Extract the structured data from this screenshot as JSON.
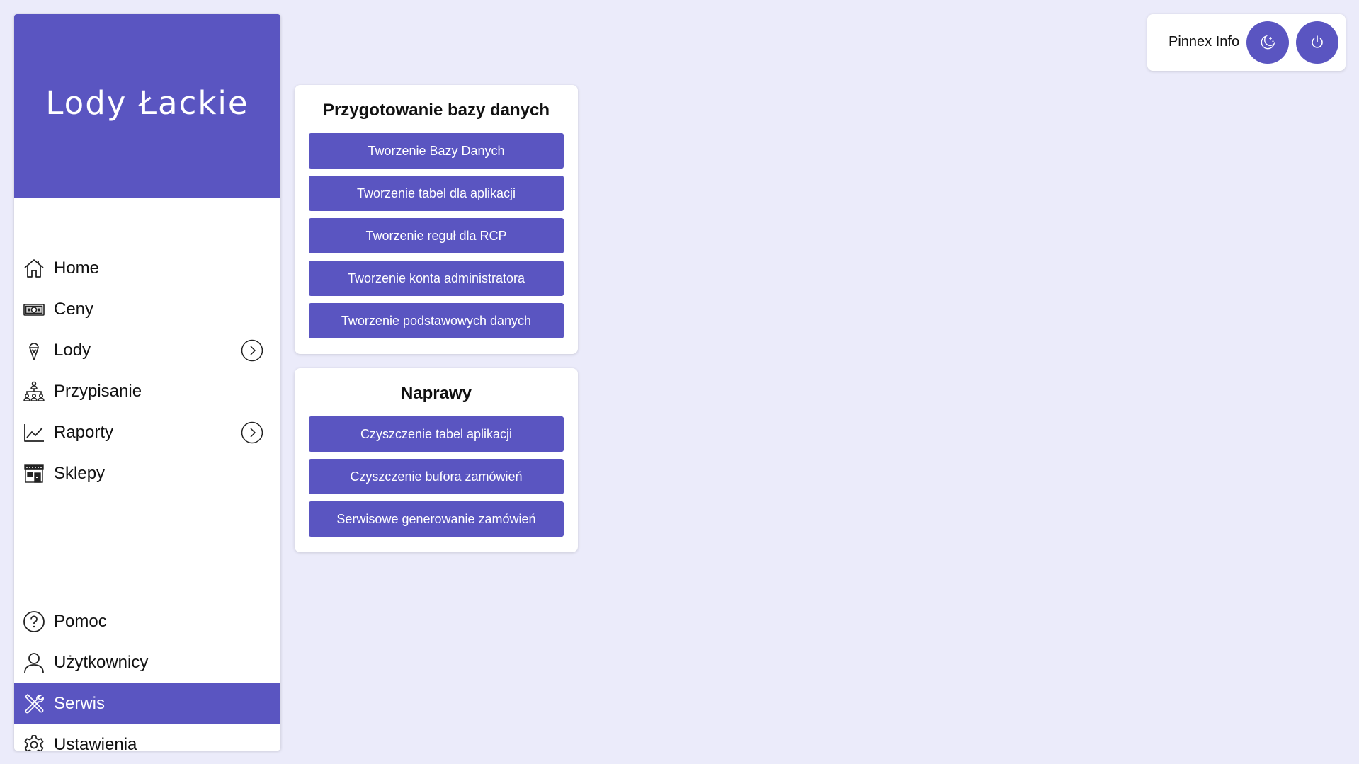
{
  "colors": {
    "accent": "#5a55c1",
    "background": "#ebebfa",
    "panel": "#ffffff"
  },
  "sidebar": {
    "brand": "Lody Łackie",
    "items": [
      {
        "label": "Home",
        "icon": "home-icon"
      },
      {
        "label": "Ceny",
        "icon": "banknote-icon"
      },
      {
        "label": "Lody",
        "icon": "ice-cream-icon",
        "expandable": true
      },
      {
        "label": "Przypisanie",
        "icon": "hierarchy-icon"
      },
      {
        "label": "Raporty",
        "icon": "line-chart-icon",
        "expandable": true
      },
      {
        "label": "Sklepy",
        "icon": "store-icon"
      }
    ],
    "bottom_items": [
      {
        "label": "Pomoc",
        "icon": "help-circle-icon"
      },
      {
        "label": "Użytkownicy",
        "icon": "user-icon"
      },
      {
        "label": "Serwis",
        "icon": "tools-icon",
        "active": true
      },
      {
        "label": "Ustawienia",
        "icon": "gear-icon"
      }
    ]
  },
  "cards": {
    "database": {
      "title": "Przygotowanie bazy danych",
      "buttons": [
        "Tworzenie Bazy Danych",
        "Tworzenie tabel dla aplikacji",
        "Tworzenie reguł dla RCP",
        "Tworzenie konta administratora",
        "Tworzenie podstawowych danych"
      ]
    },
    "repairs": {
      "title": "Naprawy",
      "buttons": [
        "Czyszczenie tabel aplikacji",
        "Czyszczenie bufora zamówień",
        "Serwisowe generowanie zamówień"
      ]
    }
  },
  "header": {
    "user_name": "Pinnex Info",
    "theme_icon": "moon-stars-icon",
    "logout_icon": "power-icon"
  }
}
